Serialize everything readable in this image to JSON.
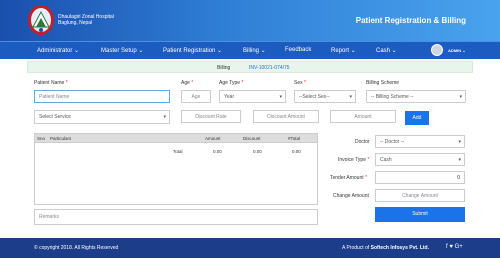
{
  "header": {
    "hospital_line1": "Dhaulagiri Zonal Hospital",
    "hospital_line2": "Baglung, Nepal",
    "title": "Patient Registration & Billing"
  },
  "nav": {
    "items": [
      {
        "label": "Administrator ⌄"
      },
      {
        "label": "Master Setup ⌄"
      },
      {
        "label": "Patient Registration ⌄"
      },
      {
        "label": "Billing ⌄"
      },
      {
        "label": "Feedback"
      },
      {
        "label": "Report ⌄"
      },
      {
        "label": "Cash ⌄"
      }
    ],
    "user": "ADMIN ⌄"
  },
  "billing": {
    "label": "Billing",
    "invoice_no": "INV-10021-074/75"
  },
  "form": {
    "patient_name_label": "Patient Name",
    "patient_name_placeholder": "Patient Name",
    "age_label": "Age",
    "age_placeholder": "Age",
    "age_type_label": "Age Type",
    "age_type_value": "Year",
    "sex_label": "Sex",
    "sex_value": "--Select Sex--",
    "billing_scheme_label": "Billing Scheme",
    "billing_scheme_value": "-- Billing Scheme --",
    "service_value": "Select Service",
    "discount_rate_placeholder": "Discount Rate",
    "discount_amount_placeholder": "Discount Amount",
    "amount_placeholder": "Amount",
    "add_label": "Add",
    "remarks_placeholder": "Remarks",
    "required_mark": "*"
  },
  "table": {
    "headers": [
      "Sno",
      "Particulars",
      "Amount",
      "Discount",
      "#Total"
    ],
    "total_label": "Total",
    "total_amount": "0.00",
    "total_discount": "0.00",
    "total_total": "0.00"
  },
  "side": {
    "doctor_label": "Doctor",
    "doctor_value": "-- Doctor --",
    "invoice_type_label": "Invoice Type",
    "invoice_type_value": "Cash",
    "tender_label": "Tender Amount",
    "tender_value": "0",
    "change_label": "Change Amount",
    "change_placeholder": "Change Amount",
    "submit_label": "Submit"
  },
  "footer": {
    "copyright": "© copyright 2018. All Rights Reserved",
    "product_prefix": "A Product of",
    "company": "Softech Infosys Pvt. Ltd.",
    "social": "f  ♥  G+"
  },
  "colors": {
    "header_start": "#1a4fae",
    "header_end": "#4aa3ee",
    "nav": "#1c5bbf",
    "accent": "#1a73e8",
    "footer": "#1c3d8a",
    "billbar": "#e8f5ec"
  }
}
